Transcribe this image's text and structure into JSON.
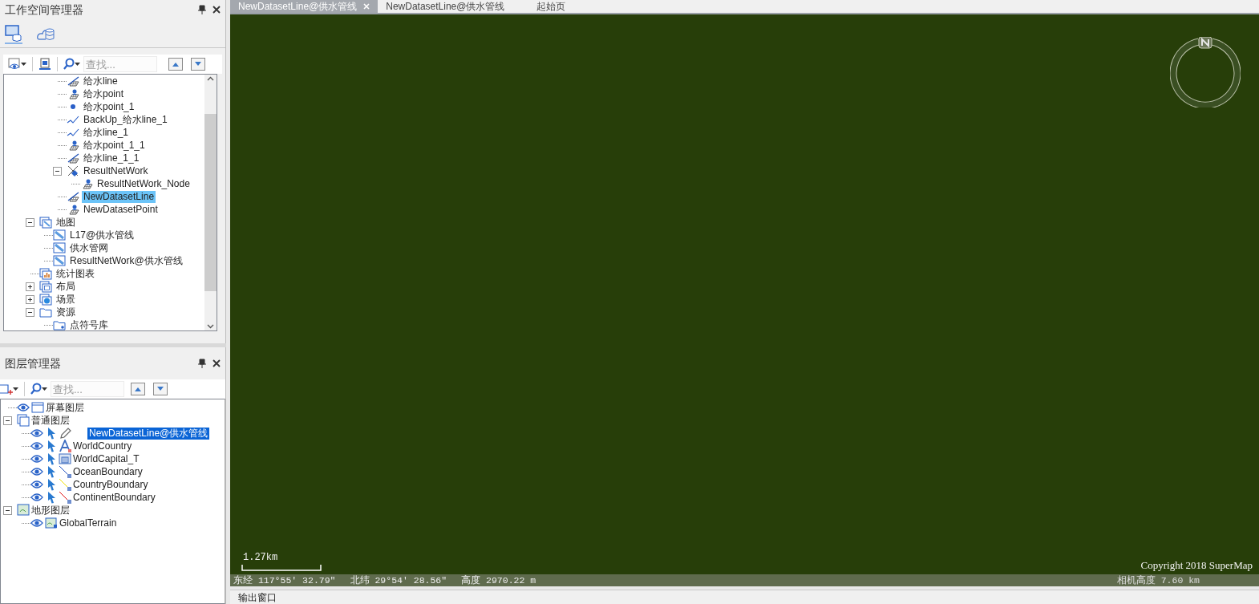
{
  "workspace_panel": {
    "title": "工作空间管理器",
    "tabs": [
      {
        "kind": "workspace",
        "selected": true
      },
      {
        "kind": "online",
        "selected": false
      }
    ],
    "search": {
      "placeholder": "查找..."
    },
    "tree": {
      "continued_items": [
        {
          "label": "给水line",
          "kind": "line",
          "selected": false
        },
        {
          "label": "给水point",
          "kind": "point",
          "selected": false
        },
        {
          "label": "给水point_1",
          "kind": "dot",
          "selected": false
        },
        {
          "label": "BackUp_给水line_1",
          "kind": "polyline",
          "selected": false
        },
        {
          "label": "给水line_1",
          "kind": "polyline",
          "selected": false
        },
        {
          "label": "给水point_1_1",
          "kind": "point",
          "selected": false
        },
        {
          "label": "给水line_1_1",
          "kind": "line",
          "selected": false
        },
        {
          "label": "ResultNetWork",
          "kind": "network",
          "selected": false,
          "expanded": true,
          "children": [
            {
              "label": "ResultNetWork_Node",
              "kind": "point",
              "selected": false
            }
          ]
        },
        {
          "label": "NewDatasetLine",
          "kind": "line",
          "selected": true
        },
        {
          "label": "NewDatasetPoint",
          "kind": "point",
          "selected": false
        }
      ],
      "items": [
        {
          "label": "地图",
          "kind": "maps",
          "selected": false,
          "expanded": true,
          "children": [
            {
              "label": "L17@供水管线",
              "kind": "map",
              "selected": false
            },
            {
              "label": "供水管网",
              "kind": "map",
              "selected": false
            },
            {
              "label": "ResultNetWork@供水管线",
              "kind": "map",
              "selected": false
            }
          ]
        },
        {
          "label": "统计图表",
          "kind": "chart",
          "selected": false
        },
        {
          "label": "布局",
          "kind": "layout",
          "selected": false,
          "expanded": false
        },
        {
          "label": "场景",
          "kind": "scene",
          "selected": false,
          "expanded": false
        },
        {
          "label": "资源",
          "kind": "folder",
          "selected": false,
          "expanded": true,
          "children": [
            {
              "label": "点符号库",
              "kind": "symbols",
              "selected": false
            }
          ]
        }
      ]
    }
  },
  "layer_panel": {
    "title": "图层管理器",
    "search": {
      "placeholder": "查找..."
    },
    "layers": [
      {
        "label": "屏幕图层",
        "kind": "screen",
        "visible": true,
        "selected": false
      },
      {
        "label": "普通图层",
        "kind": "group",
        "expanded": true,
        "selected": false,
        "children": [
          {
            "label": "NewDatasetLine@供水管线",
            "kind": "edit",
            "visible": true,
            "selectable": true,
            "selected": true
          },
          {
            "label": "WorldCountry",
            "kind": "label",
            "visible": true,
            "selectable": true,
            "selected": false
          },
          {
            "label": "WorldCapital_T",
            "kind": "theme",
            "visible": true,
            "selectable": true,
            "selected": false
          },
          {
            "label": "OceanBoundary",
            "kind": "line",
            "color": "#1f4fbf",
            "visible": true,
            "selectable": true,
            "selected": false
          },
          {
            "label": "CountryBoundary",
            "kind": "line",
            "color": "#f0e000",
            "visible": true,
            "selectable": true,
            "selected": false
          },
          {
            "label": "ContinentBoundary",
            "kind": "line",
            "color": "#e01010",
            "visible": true,
            "selectable": true,
            "selected": false
          }
        ]
      },
      {
        "label": "地形图层",
        "kind": "terrain-group",
        "expanded": true,
        "selected": false,
        "children": [
          {
            "label": "GlobalTerrain",
            "kind": "terrain",
            "visible": true,
            "selected": false
          }
        ]
      }
    ]
  },
  "map_tabs": [
    {
      "label": "NewDatasetLine@供水管线",
      "selected": true,
      "closable": true
    },
    {
      "label": "NewDatasetLine@供水管线",
      "selected": false
    },
    {
      "label": "起始页",
      "selected": false
    }
  ],
  "map": {
    "scale": "1.27km",
    "copyright": "Copyright 2018 SuperMap"
  },
  "status_bar": {
    "longitude": "东经 117°55′ 32.79″",
    "latitude": "北纬 29°54′ 28.56″",
    "altitude": "高度 2970.22 m",
    "camera_height": "相机高度 7.60 km"
  },
  "output_panel": {
    "title": "输出窗口"
  }
}
